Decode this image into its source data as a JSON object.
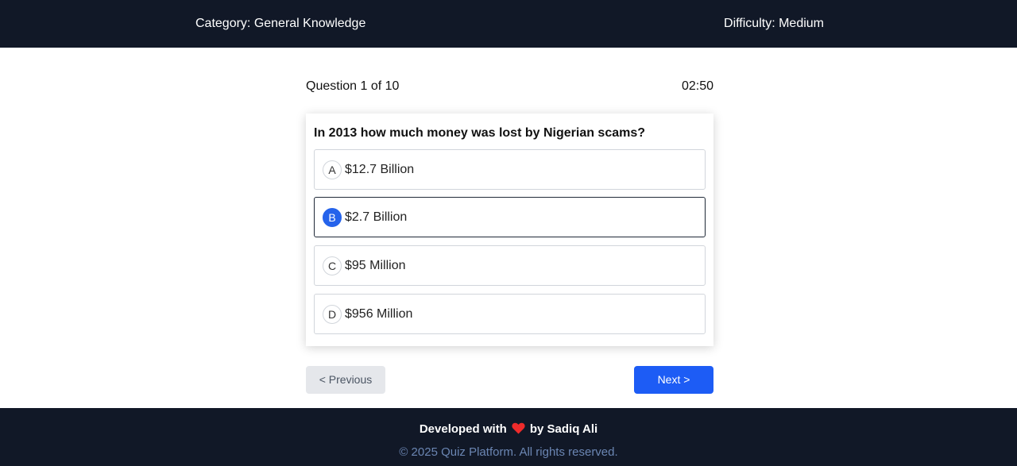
{
  "header": {
    "category": "Category: General Knowledge",
    "difficulty": "Difficulty: Medium"
  },
  "quiz": {
    "counter": "Question 1 of 10",
    "timer": "02:50",
    "question": "In 2013 how much money was lost by Nigerian scams?",
    "options": [
      {
        "letter": "A",
        "text": "$12.7 Billion",
        "selected": false
      },
      {
        "letter": "B",
        "text": "$2.7 Billion",
        "selected": true
      },
      {
        "letter": "C",
        "text": "$95 Million",
        "selected": false
      },
      {
        "letter": "D",
        "text": "$956 Million",
        "selected": false
      }
    ]
  },
  "nav": {
    "previous_label": "< Previous",
    "next_label": "Next >"
  },
  "footer": {
    "dev_prefix": "Developed with",
    "heart_icon": "heart-icon",
    "dev_suffix": "by Sadiq Ali",
    "copyright": "© 2025 Quiz Platform. All rights reserved."
  },
  "colors": {
    "dark_bg": "#111827",
    "accent": "#1d5cf5",
    "selected_letter": "#2563eb",
    "heart": "#ef2b2b",
    "footer_muted": "#6b86b3"
  }
}
